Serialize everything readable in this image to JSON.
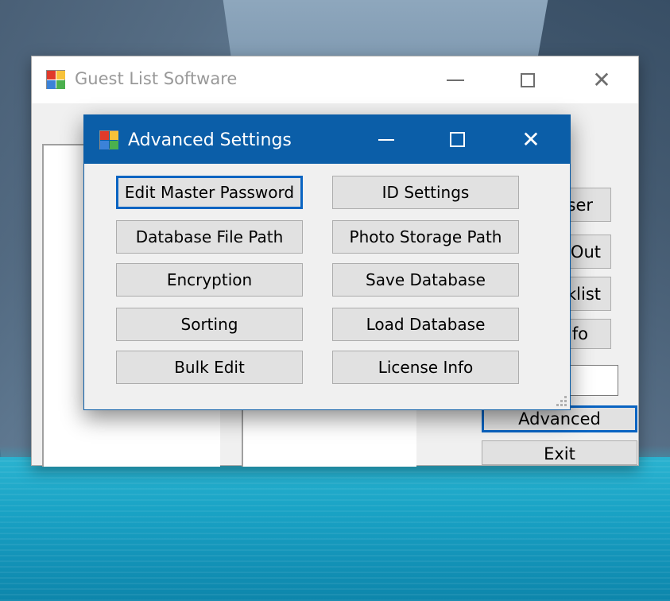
{
  "main_window": {
    "title": "Guest List Software",
    "icon": "app-icon",
    "caption_icons": [
      "minimize-icon",
      "maximize-icon",
      "close-icon"
    ],
    "side_buttons": [
      {
        "label": "Add User",
        "visible_text": "ser"
      },
      {
        "label": "Check In/Out",
        "visible_text": "/Out"
      },
      {
        "label": "Blacklist",
        "visible_text": "cklist"
      },
      {
        "label": "Info",
        "visible_text": "nfo"
      },
      {
        "label": "Advanced",
        "visible_text": "Advanced"
      },
      {
        "label": "Exit",
        "visible_text": "Exit"
      }
    ],
    "close_glyph": "✕"
  },
  "dialog": {
    "title": "Advanced Settings",
    "icon": "app-icon",
    "close_glyph": "✕",
    "left_buttons": [
      "Edit Master Password",
      "Database File Path",
      "Encryption",
      "Sorting",
      "Bulk Edit"
    ],
    "right_buttons": [
      "ID Settings",
      "Photo Storage Path",
      "Save Database",
      "Load Database",
      "License Info"
    ],
    "accent_color": "#0b5ea8"
  }
}
